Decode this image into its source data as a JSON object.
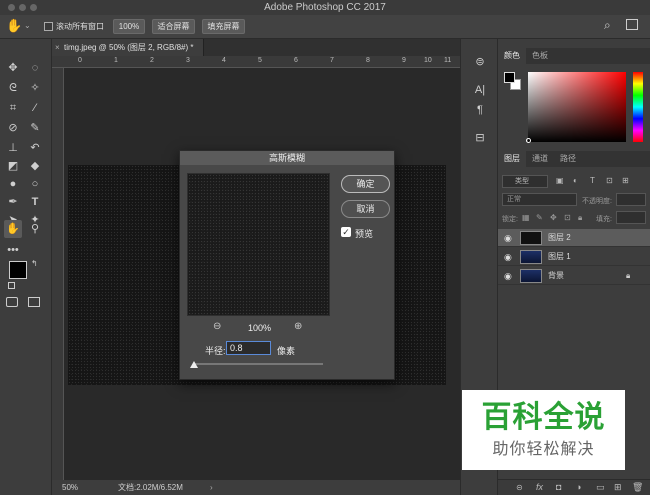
{
  "app": {
    "title": "Adobe Photoshop CC 2017"
  },
  "options_bar": {
    "scroll_all_windows": "滚动所有窗口",
    "zoom_100": "100%",
    "fit_screen": "适合屏幕",
    "fill_screen": "填充屏幕"
  },
  "document": {
    "tab_title": "timg.jpeg @ 50% (图层 2, RGB/8#) *",
    "ruler_marks": [
      "0",
      "1",
      "2",
      "3",
      "4",
      "5",
      "6",
      "7",
      "8",
      "9",
      "10",
      "11"
    ],
    "zoom": "50%",
    "file_info": "文档:2.02M/6.52M"
  },
  "panels": {
    "color_tab": "颜色",
    "swatches_tab": "色板",
    "layers_tab": "图层",
    "channels_tab": "通道",
    "paths_tab": "路径",
    "kind_filter": "类型",
    "blend_mode": "正常",
    "opacity_label": "不透明度:",
    "lock_label": "锁定:",
    "fill_label": "填充:",
    "layers": [
      {
        "name": "图层 2"
      },
      {
        "name": "图层 1"
      },
      {
        "name": "背景"
      }
    ]
  },
  "dialog": {
    "title": "高斯模糊",
    "ok_label": "确定",
    "cancel_label": "取消",
    "preview_label": "预览",
    "preview_checked": true,
    "zoom_level": "100%",
    "radius_label": "半径:",
    "radius_value": "0.8",
    "unit_label": "像素",
    "radius_fraction": 0.01
  },
  "watermark": {
    "line1": "百科全说",
    "line2": "助你轻松解决"
  },
  "colors": {
    "accent_green": "#2aa135",
    "foreground": "#000000",
    "background": "#ffffff"
  }
}
